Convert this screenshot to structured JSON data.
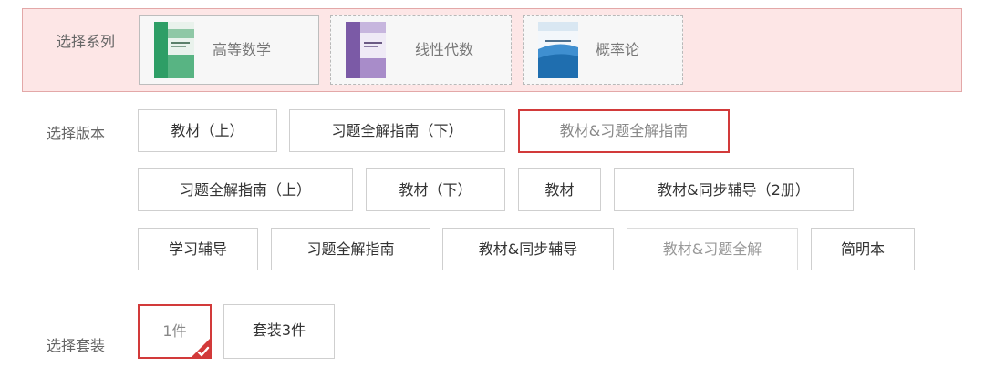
{
  "series": {
    "label": "选择系列",
    "items": [
      {
        "name": "高等数学"
      },
      {
        "name": "线性代数"
      },
      {
        "name": "概率论"
      }
    ]
  },
  "edition": {
    "label": "选择版本",
    "options": [
      "教材（上）",
      "习题全解指南（下）",
      "教材&习题全解指南",
      "习题全解指南（上）",
      "教材（下）",
      "教材",
      "教材&同步辅导（2册）",
      "学习辅导",
      "习题全解指南",
      "教材&同步辅导",
      "教材&习题全解",
      "简明本"
    ],
    "selected": "教材&习题全解指南"
  },
  "package": {
    "label": "选择套装",
    "options": [
      "1件",
      "套装3件"
    ],
    "selected": "1件"
  },
  "colors": {
    "band_bg": "#fde6e6",
    "band_border": "#e3a8a8",
    "accent_red": "#d23a3a"
  }
}
